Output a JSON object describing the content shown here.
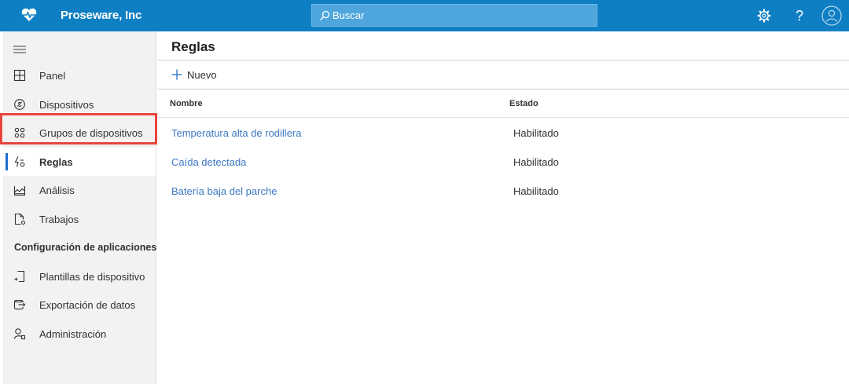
{
  "header": {
    "brand": "Proseware, Inc",
    "logo_icon": "heart-pulse-icon",
    "search": {
      "placeholder": "Buscar",
      "icon": "search-icon"
    },
    "actions": [
      "gear-icon",
      "help-icon",
      "avatar-icon"
    ],
    "help_glyph": "?",
    "bar_color": "#0f7fc4"
  },
  "sidebar": {
    "menu_icon": "hamburger-icon",
    "items": [
      {
        "label": "Panel",
        "icon": "dashboard-icon"
      },
      {
        "label": "Dispositivos",
        "icon": "devices-icon"
      },
      {
        "label": "Grupos de dispositivos",
        "icon": "device-groups-icon"
      },
      {
        "label": "Reglas",
        "icon": "rules-icon",
        "selected": true
      },
      {
        "label": "Análisis",
        "icon": "analytics-icon"
      },
      {
        "label": "Trabajos",
        "icon": "jobs-icon"
      }
    ],
    "section_title": "Configuración de aplicaciones",
    "section_items": [
      {
        "label": "Plantillas de dispositivo",
        "icon": "device-template-icon"
      },
      {
        "label": "Exportación de datos",
        "icon": "data-export-icon"
      },
      {
        "label": "Administración",
        "icon": "administration-icon"
      }
    ],
    "highlight_color": "#e8453c"
  },
  "main": {
    "title": "Reglas",
    "new_label": "Nuevo",
    "columns": [
      "Nombre",
      "Estado"
    ],
    "rows": [
      {
        "name": "Temperatura alta de rodillera",
        "state": "Habilitado"
      },
      {
        "name": "Caída detectada",
        "state": "Habilitado"
      },
      {
        "name": "Batería baja del parche",
        "state": "Habilitado"
      }
    ],
    "link_color": "#3c78c3"
  }
}
